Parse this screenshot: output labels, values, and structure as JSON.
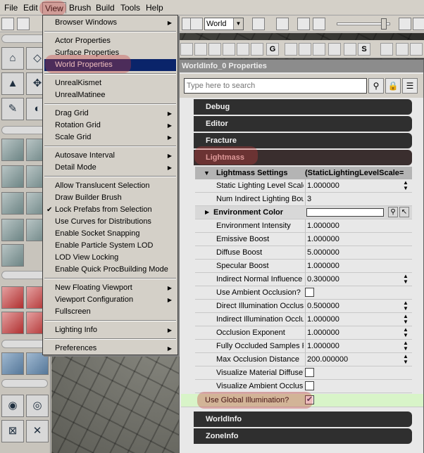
{
  "menubar": {
    "items": [
      "File",
      "Edit",
      "View",
      "Brush",
      "Build",
      "Tools",
      "Help"
    ]
  },
  "toolbar": {
    "world_select": "World"
  },
  "view_menu": {
    "items": [
      {
        "label": "Browser Windows",
        "submenu": true
      },
      {
        "label": "Actor Properties"
      },
      {
        "label": "Surface Properties"
      },
      {
        "label": "World Properties",
        "selected": true
      },
      {
        "label": "UnrealKismet"
      },
      {
        "label": "UnrealMatinee"
      },
      {
        "label": "Drag Grid",
        "submenu": true
      },
      {
        "label": "Rotation Grid",
        "submenu": true
      },
      {
        "label": "Scale Grid",
        "submenu": true
      },
      {
        "label": "Autosave Interval",
        "submenu": true
      },
      {
        "label": "Detail Mode",
        "submenu": true
      },
      {
        "label": "Allow Translucent Selection"
      },
      {
        "label": "Draw Builder Brush"
      },
      {
        "label": "Lock Prefabs from Selection",
        "checked": true
      },
      {
        "label": "Use Curves for Distributions"
      },
      {
        "label": "Enable Socket Snapping"
      },
      {
        "label": "Enable Particle System LOD"
      },
      {
        "label": "LOD View Locking"
      },
      {
        "label": "Enable Quick ProcBuilding Mode"
      },
      {
        "label": "New Floating Viewport",
        "submenu": true
      },
      {
        "label": "Viewport Configuration",
        "submenu": true
      },
      {
        "label": "Fullscreen"
      },
      {
        "label": "Lighting Info",
        "submenu": true
      },
      {
        "label": "Preferences",
        "submenu": true
      }
    ]
  },
  "properties": {
    "title": "WorldInfo_0 Properties",
    "search_placeholder": "Type here to search",
    "categories": {
      "debug": "Debug",
      "editor": "Editor",
      "fracture": "Fracture",
      "lightmass": "Lightmass",
      "worldinfo": "WorldInfo",
      "zoneinfo": "ZoneInfo"
    },
    "lightmass_settings": {
      "label": "Lightmass Settings",
      "value": "(StaticLightingLevelScale="
    },
    "rows": [
      {
        "label": "Static Lighting Level Scale",
        "value": "1.000000"
      },
      {
        "label": "Num Indirect Lighting Bou",
        "value": "3"
      },
      {
        "label": "Environment Intensity",
        "value": "1.000000"
      },
      {
        "label": "Emissive Boost",
        "value": "1.000000"
      },
      {
        "label": "Diffuse Boost",
        "value": "5.000000"
      },
      {
        "label": "Specular Boost",
        "value": "1.000000"
      },
      {
        "label": "Indirect Normal Influence",
        "value": "0.300000"
      },
      {
        "label": "Use Ambient Occlusion?",
        "value": ""
      },
      {
        "label": "Direct Illumination Occlusi",
        "value": "0.500000"
      },
      {
        "label": "Indirect Illumination Occlu",
        "value": "1.000000"
      },
      {
        "label": "Occlusion Exponent",
        "value": "1.000000"
      },
      {
        "label": "Fully Occluded Samples Fr",
        "value": "1.000000"
      },
      {
        "label": "Max Occlusion Distance",
        "value": "200.000000"
      },
      {
        "label": "Visualize Material Diffuse?",
        "value": ""
      },
      {
        "label": "Visualize Ambient Occlusio",
        "value": ""
      }
    ],
    "environment_color_label": "Environment Color",
    "use_global_illumination": {
      "label": "Use Global Illumination?",
      "checked": true
    }
  },
  "colors": {
    "menu_highlight": "#0a246a",
    "annotation_ring": "#c83c3c",
    "gi_row": "#d8f4c8"
  }
}
